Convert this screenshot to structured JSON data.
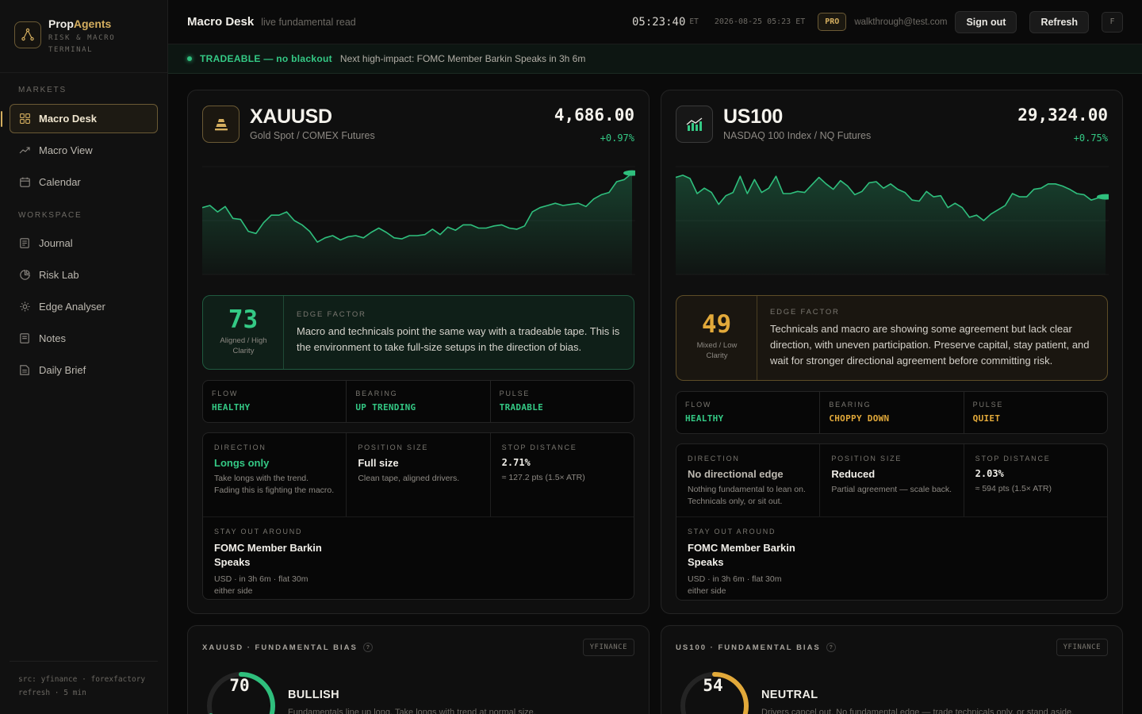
{
  "brand": {
    "name_a": "Prop",
    "name_b": "Agents",
    "tagline": "RISK & MACRO TERMINAL"
  },
  "sidebar": {
    "markets_label": "MARKETS",
    "workspace_label": "WORKSPACE",
    "markets": [
      {
        "label": "Macro Desk",
        "icon": "grid-icon",
        "active": true
      },
      {
        "label": "Macro View",
        "icon": "trend-icon"
      },
      {
        "label": "Calendar",
        "icon": "calendar-icon"
      }
    ],
    "workspace": [
      {
        "label": "Journal",
        "icon": "journal-icon"
      },
      {
        "label": "Risk Lab",
        "icon": "risk-icon"
      },
      {
        "label": "Edge Analyser",
        "icon": "sun-icon"
      },
      {
        "label": "Notes",
        "icon": "notes-icon"
      },
      {
        "label": "Daily Brief",
        "icon": "brief-icon"
      }
    ],
    "footer_src": "src: yfinance · forexfactory",
    "footer_refresh": "refresh · 5 min"
  },
  "header": {
    "title": "Macro Desk",
    "subtitle": "live fundamental read",
    "clock": "05:23:40",
    "clock_tz": "ET",
    "date": "2026-08-25 05:23 ET",
    "plan_badge": "PRO",
    "email": "walkthrough@test.com",
    "sign_out": "Sign out",
    "refresh": "Refresh",
    "f_key": "F"
  },
  "banner": {
    "status": "TRADEABLE — no blackout",
    "next": "Next high-impact: FOMC Member Barkin Speaks in 3h 6m"
  },
  "colors": {
    "accent": "#d4ae5f",
    "positive": "#34c985",
    "warning": "#e2a93a",
    "bg": "#0a0a0a"
  },
  "assets": [
    {
      "symbol": "XAUUSD",
      "name": "Gold Spot / COMEX Futures",
      "price": "4,686.00",
      "change": "+0.97%",
      "icon": "gold-bar-icon",
      "edge": {
        "score": "73",
        "caption": "Aligned / High Clarity",
        "label": "EDGE FACTOR",
        "text": "Macro and technicals point the same way with a tradeable tape. This is the environment to take full-size setups in the direction of bias."
      },
      "stats": [
        {
          "label": "FLOW",
          "value": "HEALTHY"
        },
        {
          "label": "BEARING",
          "value": "UP TRENDING"
        },
        {
          "label": "PULSE",
          "value": "TRADABLE"
        }
      ],
      "plan": {
        "direction_label": "DIRECTION",
        "direction": "Longs only",
        "direction_note": "Take longs with the trend. Fading this is fighting the macro.",
        "size_label": "POSITION SIZE",
        "size": "Full size",
        "size_note": "Clean tape, aligned drivers.",
        "stop_label": "STOP DISTANCE",
        "stop": "2.71%",
        "stop_note": "≈ 127.2 pts (1.5× ATR)",
        "stay_label": "STAY OUT AROUND",
        "stay": "FOMC Member Barkin Speaks",
        "stay_note": "USD · in 3h 6m · flat 30m either side"
      },
      "bias": {
        "title": "XAUUSD · FUNDAMENTAL BIAS",
        "source": "YFINANCE",
        "score": "70",
        "label": "BULLISH",
        "desc": "Fundamentals line up long. Take longs with trend at normal size."
      }
    },
    {
      "symbol": "US100",
      "name": "NASDAQ 100 Index / NQ Futures",
      "price": "29,324.00",
      "change": "+0.75%",
      "icon": "chart-bars-icon",
      "edge": {
        "score": "49",
        "caption": "Mixed / Low Clarity",
        "label": "EDGE FACTOR",
        "text": "Technicals and macro are showing some agreement but lack clear direction, with uneven participation. Preserve capital, stay patient, and wait for stronger directional agreement before committing risk."
      },
      "stats": [
        {
          "label": "FLOW",
          "value": "HEALTHY"
        },
        {
          "label": "BEARING",
          "value": "CHOPPY DOWN"
        },
        {
          "label": "PULSE",
          "value": "QUIET"
        }
      ],
      "plan": {
        "direction_label": "DIRECTION",
        "direction": "No directional edge",
        "direction_note": "Nothing fundamental to lean on. Technicals only, or sit out.",
        "size_label": "POSITION SIZE",
        "size": "Reduced",
        "size_note": "Partial agreement — scale back.",
        "stop_label": "STOP DISTANCE",
        "stop": "2.03%",
        "stop_note": "≈ 594 pts (1.5× ATR)",
        "stay_label": "STAY OUT AROUND",
        "stay": "FOMC Member Barkin Speaks",
        "stay_note": "USD · in 3h 6m · flat 30m either side"
      },
      "bias": {
        "title": "US100 · FUNDAMENTAL BIAS",
        "source": "YFINANCE",
        "score": "54",
        "label": "NEUTRAL",
        "desc": "Drivers cancel out. No fundamental edge — trade technicals only, or stand aside."
      }
    }
  ],
  "chart_data": [
    {
      "type": "area",
      "series": [
        {
          "values": [
            62,
            64,
            58,
            63,
            52,
            51,
            40,
            38,
            48,
            55,
            55,
            58,
            50,
            46,
            40,
            30,
            34,
            36,
            32,
            35,
            36,
            34,
            39,
            43,
            39,
            34,
            33,
            36,
            36,
            37,
            42,
            37,
            44,
            41,
            46,
            46,
            43,
            43,
            45,
            46,
            43,
            42,
            45,
            58,
            62,
            64,
            66,
            64,
            65,
            66,
            63,
            70,
            74,
            76,
            86,
            88,
            94
          ]
        }
      ]
    },
    {
      "type": "area",
      "series": [
        {
          "values": [
            90,
            92,
            89,
            75,
            80,
            76,
            65,
            73,
            76,
            91,
            75,
            88,
            76,
            80,
            91,
            75,
            75,
            77,
            76,
            83,
            90,
            84,
            79,
            87,
            82,
            74,
            77,
            85,
            86,
            80,
            84,
            79,
            76,
            69,
            68,
            77,
            72,
            73,
            62,
            66,
            62,
            53,
            55,
            50,
            56,
            60,
            64,
            75,
            72,
            72,
            79,
            80,
            84,
            84,
            82,
            79,
            75,
            74,
            69,
            71,
            72
          ]
        }
      ]
    }
  ]
}
